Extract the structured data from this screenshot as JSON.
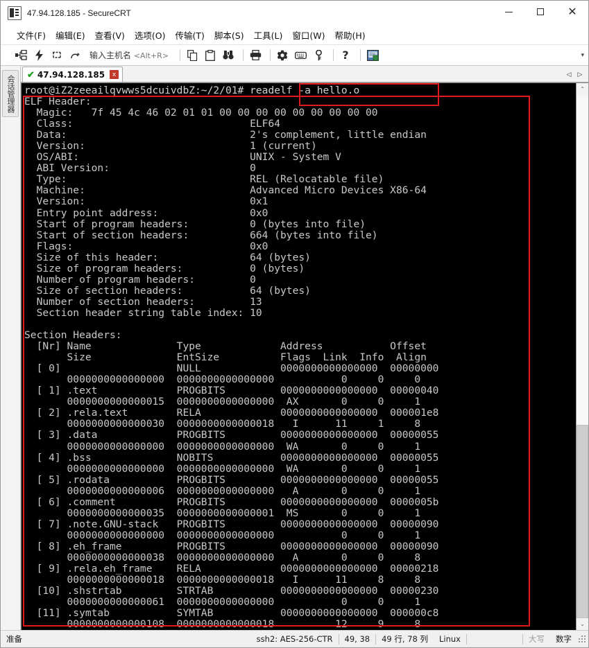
{
  "window": {
    "title": "47.94.128.185 - SecureCRT",
    "app_icon": "securecrt-icon",
    "minimize": "–",
    "maximize": "□",
    "close": "✕"
  },
  "menubar": {
    "items": [
      {
        "label": "文件(F)",
        "name": "menu-file"
      },
      {
        "label": "编辑(E)",
        "name": "menu-edit"
      },
      {
        "label": "查看(V)",
        "name": "menu-view"
      },
      {
        "label": "选项(O)",
        "name": "menu-options"
      },
      {
        "label": "传输(T)",
        "name": "menu-transfer"
      },
      {
        "label": "脚本(S)",
        "name": "menu-script"
      },
      {
        "label": "工具(L)",
        "name": "menu-tools"
      },
      {
        "label": "窗口(W)",
        "name": "menu-window"
      },
      {
        "label": "帮助(H)",
        "name": "menu-help"
      }
    ]
  },
  "toolbar": {
    "host_label": "输入主机名",
    "host_hint": "<Alt+R>",
    "overflow": "▾",
    "icons": [
      {
        "name": "new-session-icon",
        "glyph": "connect"
      },
      {
        "name": "quick-connect-icon",
        "glyph": "bolt"
      },
      {
        "name": "reconnect-icon",
        "glyph": "reconnect"
      },
      {
        "name": "disconnect-icon",
        "glyph": "disconnect"
      },
      {
        "name": "copy-icon",
        "glyph": "copy"
      },
      {
        "name": "paste-icon",
        "glyph": "paste"
      },
      {
        "name": "find-icon",
        "glyph": "binoculars"
      },
      {
        "name": "print-icon",
        "glyph": "printer"
      },
      {
        "name": "session-options-icon",
        "glyph": "gear"
      },
      {
        "name": "keymap-editor-icon",
        "glyph": "keyboard"
      },
      {
        "name": "key-icon",
        "glyph": "key"
      },
      {
        "name": "help-icon",
        "glyph": "question"
      },
      {
        "name": "arrange-icon",
        "glyph": "window"
      }
    ]
  },
  "sidebar": {
    "tabs": [
      {
        "label": "会话管理器",
        "name": "sidebar-tab-session-manager"
      }
    ]
  },
  "tabstrip": {
    "tabs": [
      {
        "label": "47.94.128.185",
        "status": "connected",
        "check": "✔",
        "close": "x"
      }
    ],
    "nav_prev": "◁",
    "nav_next": "▷"
  },
  "terminal": {
    "prompt": "root@iZ2zeeailqvwws5dcuivdbZ:~/2/01# ",
    "command": "readelf -a hello.o",
    "lines": [
      "ELF Header:",
      "  Magic:   7f 45 4c 46 02 01 01 00 00 00 00 00 00 00 00 00",
      "  Class:                             ELF64",
      "  Data:                              2's complement, little endian",
      "  Version:                           1 (current)",
      "  OS/ABI:                            UNIX - System V",
      "  ABI Version:                       0",
      "  Type:                              REL (Relocatable file)",
      "  Machine:                           Advanced Micro Devices X86-64",
      "  Version:                           0x1",
      "  Entry point address:               0x0",
      "  Start of program headers:          0 (bytes into file)",
      "  Start of section headers:          664 (bytes into file)",
      "  Flags:                             0x0",
      "  Size of this header:               64 (bytes)",
      "  Size of program headers:           0 (bytes)",
      "  Number of program headers:         0",
      "  Size of section headers:           64 (bytes)",
      "  Number of section headers:         13",
      "  Section header string table index: 10",
      "",
      "Section Headers:",
      "  [Nr] Name              Type             Address           Offset",
      "       Size              EntSize          Flags  Link  Info  Align",
      "  [ 0]                   NULL             0000000000000000  00000000",
      "       0000000000000000  0000000000000000           0     0     0",
      "  [ 1] .text             PROGBITS         0000000000000000  00000040",
      "       0000000000000015  0000000000000000  AX       0     0     1",
      "  [ 2] .rela.text        RELA             0000000000000000  000001e8",
      "       0000000000000030  0000000000000018   I      11     1     8",
      "  [ 3] .data             PROGBITS         0000000000000000  00000055",
      "       0000000000000000  0000000000000000  WA       0     0     1",
      "  [ 4] .bss              NOBITS           0000000000000000  00000055",
      "       0000000000000000  0000000000000000  WA       0     0     1",
      "  [ 5] .rodata           PROGBITS         0000000000000000  00000055",
      "       0000000000000006  0000000000000000   A       0     0     1",
      "  [ 6] .comment          PROGBITS         0000000000000000  0000005b",
      "       0000000000000035  0000000000000001  MS       0     0     1",
      "  [ 7] .note.GNU-stack   PROGBITS         0000000000000000  00000090",
      "       0000000000000000  0000000000000000           0     0     1",
      "  [ 8] .eh_frame         PROGBITS         0000000000000000  00000090",
      "       0000000000000038  0000000000000000   A       0     0     8",
      "  [ 9] .rela.eh_frame    RELA             0000000000000000  00000218",
      "       0000000000000018  0000000000000018   I      11     8     8",
      "  [10] .shstrtab         STRTAB           0000000000000000  00000230",
      "       0000000000000061  0000000000000000           0     0     1",
      "  [11] .symtab           SYMTAB           0000000000000000  000000c8",
      "       0000000000000108  0000000000000018          12     9     8"
    ],
    "scroll_up": "⌃",
    "scroll_down": "⌄"
  },
  "annotations": {
    "command_box_color": "#e01b1b",
    "output_box_color": "#e01b1b"
  },
  "statusbar": {
    "ready": "准备",
    "cipher": "ssh2: AES-256-CTR",
    "cursor": "49, 38",
    "dimensions": "49 行, 78 列",
    "emulation": "Linux",
    "caps": "大写",
    "num": "数字"
  }
}
